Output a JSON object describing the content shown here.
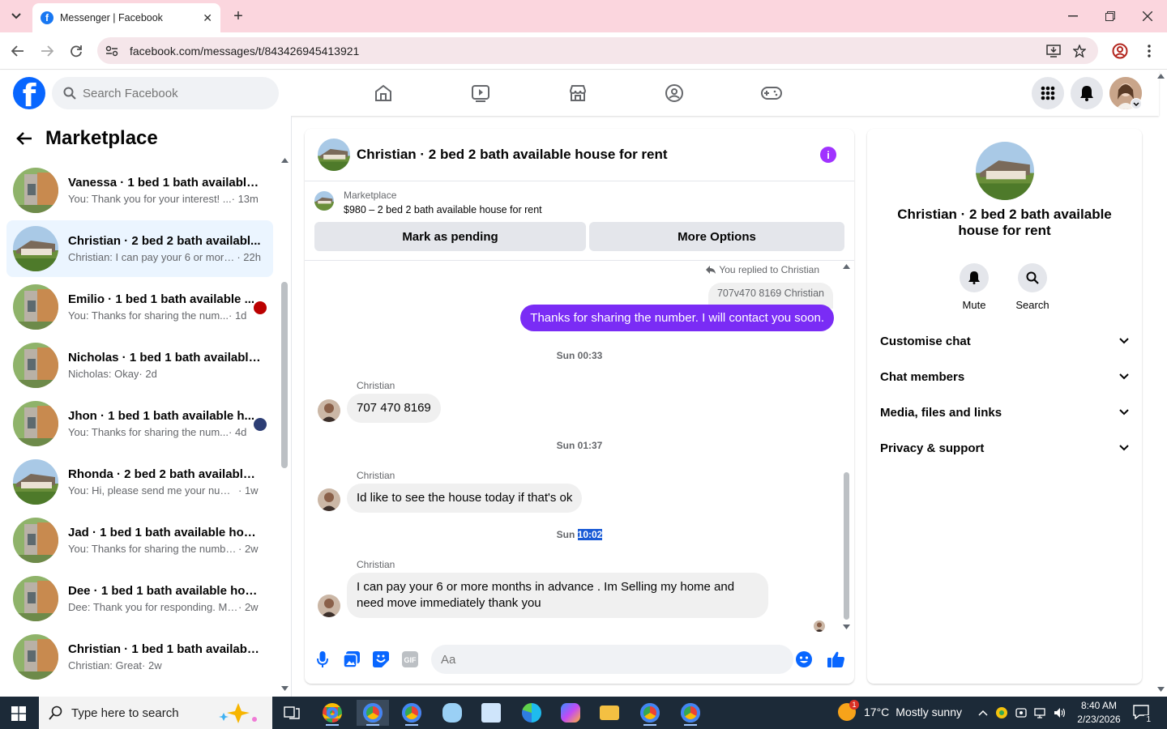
{
  "browser": {
    "tab_title": "Messenger | Facebook",
    "url": "facebook.com/messages/t/843426945413921"
  },
  "fbnav": {
    "search_placeholder": "Search Facebook"
  },
  "sidebar": {
    "title": "Marketplace",
    "conversations": [
      {
        "name": "Vanessa · 1 bed 1 bath available ...",
        "preview": "You: Thank you for your interest! ...",
        "time": "· 13m",
        "active": false
      },
      {
        "name": "Christian · 2 bed 2 bath availabl...",
        "preview": "Christian: I can pay your 6 or more...",
        "time": "· 22h",
        "active": true
      },
      {
        "name": "Emilio · 1 bed 1 bath available ...",
        "preview": "You: Thanks for sharing the num...",
        "time": "· 1d",
        "active": false
      },
      {
        "name": "Nicholas · 1 bed 1 bath available ...",
        "preview": "Nicholas: Okay",
        "time": "· 2d",
        "active": false
      },
      {
        "name": "Jhon · 1 bed 1 bath available h...",
        "preview": "You: Thanks for sharing the num...",
        "time": "· 4d",
        "active": false
      },
      {
        "name": "Rhonda · 2 bed 2 bath available ...",
        "preview": "You: Hi, please send me your numb...",
        "time": "· 1w",
        "active": false
      },
      {
        "name": "Jad · 1 bed 1 bath available hous...",
        "preview": "You: Thanks for sharing the numbe...",
        "time": "· 2w",
        "active": false
      },
      {
        "name": "Dee · 1 bed 1 bath available hous...",
        "preview": "Dee: Thank you for responding. My...",
        "time": "· 2w",
        "active": false
      },
      {
        "name": "Christian · 1 bed 1 bath available...",
        "preview": "Christian: Great",
        "time": "· 2w",
        "active": false
      }
    ]
  },
  "chat": {
    "title": "Christian · 2 bed 2 bath available house for rent",
    "marketplace_label": "Marketplace",
    "listing": "$980 – 2 bed 2 bath available house for rent",
    "mark_pending": "Mark as pending",
    "more_options": "More Options",
    "replied_note": "You replied to Christian",
    "quoted": "707v470 8169 Christian",
    "my_message": "Thanks for sharing the number. I will contact you soon.",
    "ts1": "Sun 00:33",
    "sender": "Christian",
    "msg1": "707 470 8169",
    "ts2": "Sun 01:37",
    "msg2": "Id like to see the house today if that's ok",
    "ts3_day": "Sun",
    "ts3_time": "10:02",
    "msg3_line1": "I can pay your 6  or more months in advance . Im Selling my home and",
    "msg3_line2": "need move immediately  thank you",
    "composer_placeholder": "Aa",
    "accent": "#7a2cf5"
  },
  "rpanel": {
    "name": "Christian · 2 bed 2 bath available house for rent",
    "mute": "Mute",
    "search": "Search",
    "sections": [
      "Customise chat",
      "Chat members",
      "Media, files and links",
      "Privacy & support"
    ]
  },
  "taskbar": {
    "search_placeholder": "Type here to search",
    "weather_temp": "17°C",
    "weather_desc": "Mostly sunny",
    "time": "8:40 AM",
    "date": "2/23/2026",
    "notif_count": "1",
    "weather_badge": "1"
  }
}
